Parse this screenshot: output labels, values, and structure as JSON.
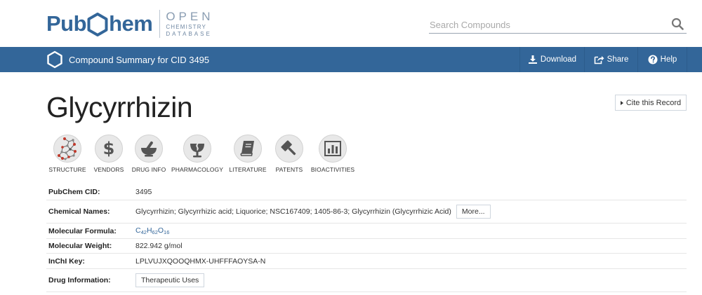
{
  "header": {
    "logo_left": "Pub",
    "logo_right": "hem",
    "logo_open": "OPEN",
    "logo_chemistry": "CHEMISTRY",
    "logo_database": "DATABASE",
    "search_placeholder": "Search Compounds",
    "search_value": ""
  },
  "navbar": {
    "title": "Compound Summary for CID 3495",
    "download_label": "Download",
    "share_label": "Share",
    "help_label": "Help"
  },
  "page": {
    "title": "Glycyrrhizin",
    "cite_label": "Cite this Record"
  },
  "sections": [
    {
      "label": "STRUCTURE",
      "icon": "structure-icon"
    },
    {
      "label": "VENDORS",
      "icon": "dollar-icon"
    },
    {
      "label": "DRUG INFO",
      "icon": "mortar-pestle-icon"
    },
    {
      "label": "PHARMACOLOGY",
      "icon": "pharmacy-icon"
    },
    {
      "label": "LITERATURE",
      "icon": "book-icon"
    },
    {
      "label": "PATENTS",
      "icon": "gavel-icon"
    },
    {
      "label": "BIOACTIVITIES",
      "icon": "bar-chart-icon"
    }
  ],
  "info": {
    "cid_label": "PubChem CID:",
    "cid_value": "3495",
    "names_label": "Chemical Names:",
    "names_value": "Glycyrrhizin; Glycyrrhizic acid; Liquorice; NSC167409; 1405-86-3; Glycyrrhizin (Glycyrrhizic Acid)",
    "names_more": "More...",
    "formula_label": "Molecular Formula:",
    "formula": {
      "c": "C",
      "c_n": "42",
      "h": "H",
      "h_n": "62",
      "o": "O",
      "o_n": "16"
    },
    "weight_label": "Molecular Weight:",
    "weight_value": "822.942 g/mol",
    "inchi_label": "InChI Key:",
    "inchi_value": "LPLVUJXQOOQHMX-UHFFFAOYSA-N",
    "drug_label": "Drug Information:",
    "drug_button": "Therapeutic Uses"
  },
  "colors": {
    "brand_blue": "#336699",
    "nav_divider": "#2c5c8c",
    "icon_circle": "#e8e8e8",
    "icon_glyph": "#555555"
  }
}
